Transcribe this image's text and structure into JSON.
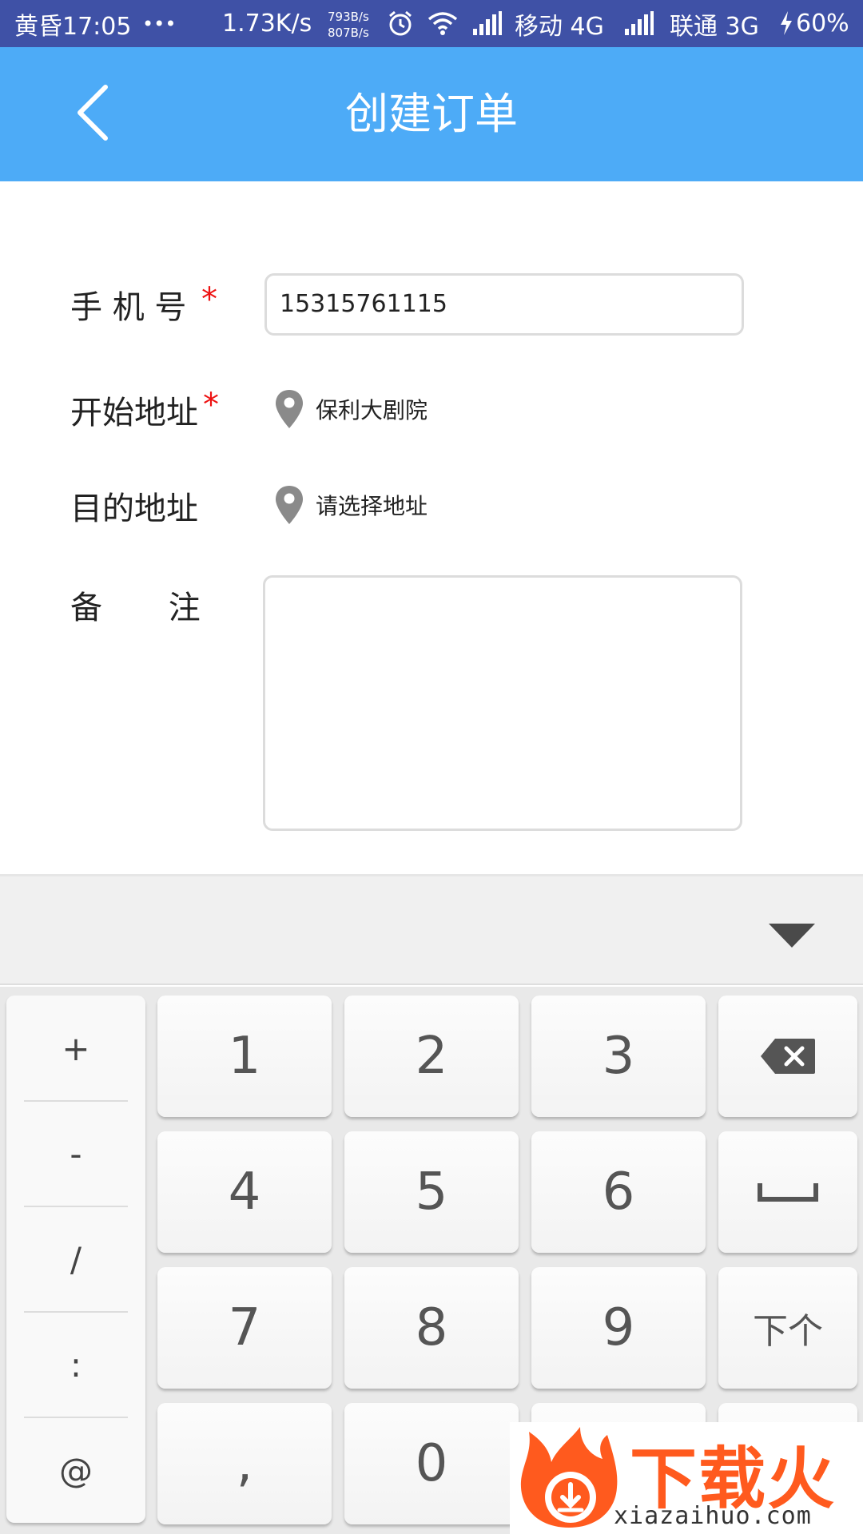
{
  "status_bar": {
    "time": "黄昏17:05",
    "more": "•••",
    "speed": "1.73K/s",
    "upload": "793B/s",
    "download": "807B/s",
    "carrier1": "移动 4G",
    "carrier2": "联通 3G",
    "battery": "60%"
  },
  "app_bar": {
    "title": "创建订单"
  },
  "form": {
    "phone_label": "手 机 号",
    "phone_value": "15315761115",
    "start_label": "开始地址",
    "start_value": "保利大剧院",
    "dest_label": "目的地址",
    "dest_placeholder": "请选择地址",
    "remark_label": "备　 注",
    "required_mark": "*"
  },
  "keyboard": {
    "symbols": [
      "+",
      "-",
      "/",
      ":",
      "@"
    ],
    "digits": [
      "1",
      "2",
      "3",
      "4",
      "5",
      "6",
      "7",
      "8",
      "9",
      ",",
      "0"
    ],
    "next_label": "下个"
  },
  "watermark": {
    "brand": "下载火",
    "url": "xiazaihuo.com"
  },
  "colors": {
    "status_bar": "#3f51a6",
    "app_bar": "#4dabf7",
    "required": "#ee1111",
    "watermark": "#ff5a1e"
  }
}
